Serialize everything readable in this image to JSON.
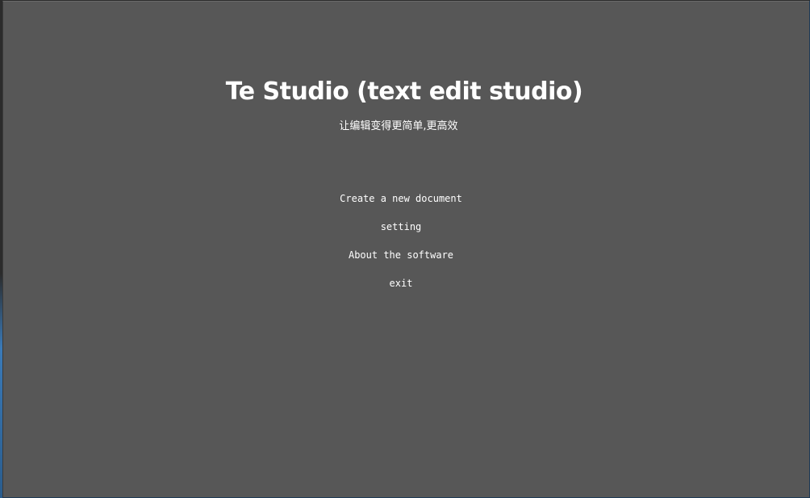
{
  "app": {
    "title": "Te Studio (text edit studio)",
    "subtitle": "让编辑变得更简单,更高效"
  },
  "menu": {
    "items": [
      {
        "label": "Create a new document"
      },
      {
        "label": "setting"
      },
      {
        "label": "About the software"
      },
      {
        "label": "exit"
      }
    ]
  },
  "colors": {
    "background": "#575757",
    "text": "#ffffff"
  }
}
